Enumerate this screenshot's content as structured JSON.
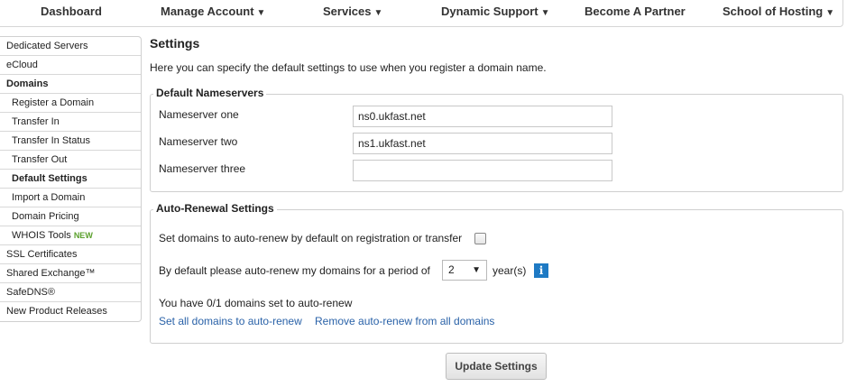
{
  "nav": {
    "items": [
      {
        "label": "Dashboard",
        "caret": ""
      },
      {
        "label": "Manage Account",
        "caret": "▼"
      },
      {
        "label": "Services",
        "caret": "▼"
      },
      {
        "label": "Dynamic Support",
        "caret": "▼"
      },
      {
        "label": "Become A Partner",
        "caret": ""
      },
      {
        "label": "School of Hosting",
        "caret": "▼"
      }
    ]
  },
  "sidebar": {
    "items": [
      {
        "label": "Dedicated Servers"
      },
      {
        "label": "eCloud"
      },
      {
        "label": "Domains"
      },
      {
        "label": "Register a Domain"
      },
      {
        "label": "Transfer In"
      },
      {
        "label": "Transfer In Status"
      },
      {
        "label": "Transfer Out"
      },
      {
        "label": "Default Settings"
      },
      {
        "label": "Import a Domain"
      },
      {
        "label": "Domain Pricing"
      },
      {
        "label": "WHOIS Tools",
        "badge": "NEW"
      },
      {
        "label": "SSL Certificates"
      },
      {
        "label": "Shared Exchange™"
      },
      {
        "label": "SafeDNS®"
      },
      {
        "label": "New Product Releases"
      }
    ]
  },
  "main": {
    "title": "Settings",
    "intro": "Here you can specify the default settings to use when you register a domain name."
  },
  "nameservers": {
    "legend": "Default Nameservers",
    "fields": [
      {
        "label": "Nameserver one",
        "value": "ns0.ukfast.net"
      },
      {
        "label": "Nameserver two",
        "value": "ns1.ukfast.net"
      },
      {
        "label": "Nameserver three",
        "value": ""
      }
    ]
  },
  "autorenew": {
    "legend": "Auto-Renewal Settings",
    "default_label": "Set domains to auto-renew by default on registration or transfer",
    "checked": false,
    "period_label": "By default please auto-renew my domains for a period of",
    "period_value": "2",
    "period_caret": "▼",
    "period_unit": "year(s)",
    "info_icon": "i",
    "status": "You have 0/1 domains set to auto-renew",
    "link_set_all": "Set all domains to auto-renew",
    "link_remove_all": "Remove auto-renew from all domains"
  },
  "buttons": {
    "update": "Update Settings"
  },
  "colors": {
    "link": "#2a62a8",
    "info_icon_bg": "#1e7ac4",
    "new_badge": "#5aa02c"
  }
}
